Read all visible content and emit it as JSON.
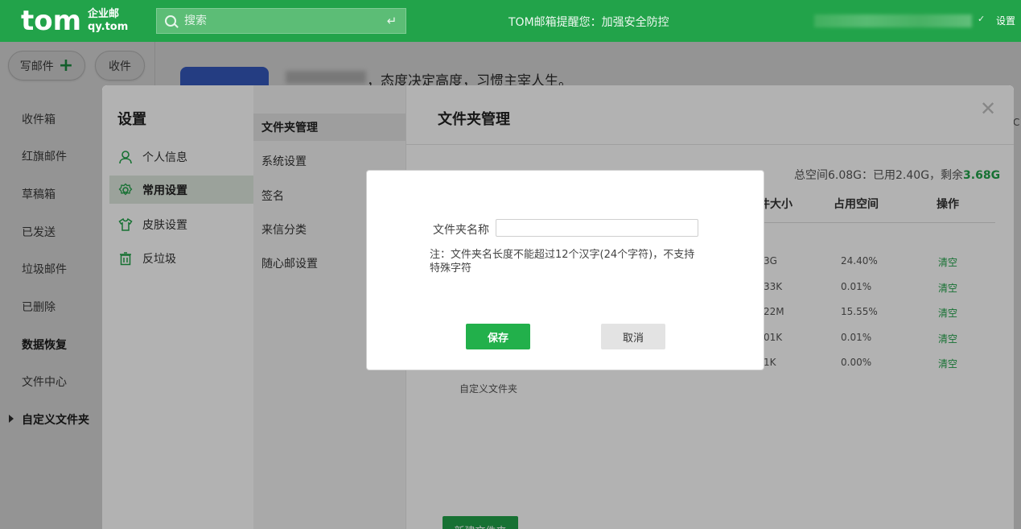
{
  "header": {
    "logo_main": "tom",
    "logo_sub_1": "企业邮",
    "logo_sub_2": "qy.tom",
    "search_placeholder": "搜索",
    "notice": "TOM邮箱提醒您：加强安全防控",
    "settings_link": "设置",
    "accent": "#22a34a"
  },
  "sidebar": {
    "compose": "写邮件",
    "receive": "收件",
    "items": [
      "收件箱",
      "红旗邮件",
      "草稿箱",
      "已发送",
      "垃圾邮件",
      "已删除",
      "数据恢复",
      "文件中心",
      "自定义文件夹"
    ]
  },
  "banner": {
    "text": "，态度决定高度，习惯主宰人生。",
    "side_char": "C"
  },
  "settings": {
    "title": "设置",
    "col1": [
      {
        "label": "个人信息",
        "icon": "user-icon"
      },
      {
        "label": "常用设置",
        "icon": "gear-icon"
      },
      {
        "label": "皮肤设置",
        "icon": "shirt-icon"
      },
      {
        "label": "反垃圾",
        "icon": "trash-icon"
      }
    ],
    "col2": [
      "文件夹管理",
      "系统设置",
      "签名",
      "来信分类",
      "随心邮设置"
    ],
    "panel_title": "文件夹管理",
    "stats_prefix": "总空间6.08G：已用2.40G，剩余",
    "stats_free": "3.68G",
    "columns": [
      "文件大小",
      "占用空间",
      "操作"
    ],
    "rows": [
      {
        "size": "3G",
        "percent": "24.40%",
        "action": "清空"
      },
      {
        "size": "33K",
        "percent": "0.01%",
        "action": "清空"
      },
      {
        "size": "22M",
        "percent": "15.55%",
        "action": "清空"
      },
      {
        "size": "01K",
        "percent": "0.01%",
        "action": "清空"
      },
      {
        "size": "1K",
        "percent": "0.00%",
        "action": "清空"
      }
    ],
    "custom_folder": "自定义文件夹",
    "new_folder": "新建文件夹"
  },
  "dialog": {
    "label": "文件夹名称",
    "input_value": "",
    "note": "注：文件夹名长度不能超过12个汉字(24个字符)，不支持特殊字符",
    "save": "保存",
    "cancel": "取消"
  }
}
